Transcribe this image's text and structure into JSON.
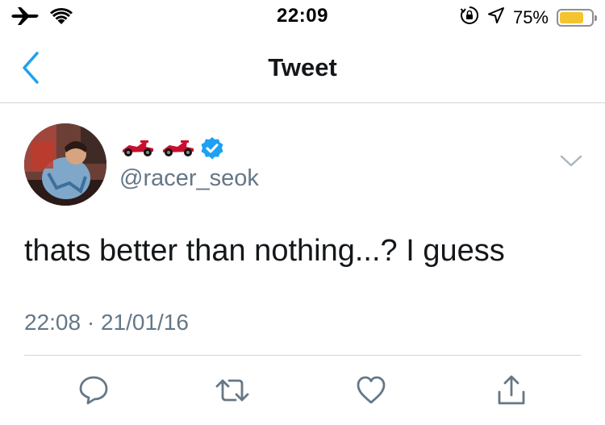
{
  "status_bar": {
    "time": "22:09",
    "battery_percent": "75%",
    "battery_level": 0.75,
    "icons": [
      "airplane-icon",
      "wifi-icon",
      "orientation-lock-icon",
      "location-icon",
      "battery-icon"
    ]
  },
  "nav": {
    "title": "Tweet",
    "back_icon": "chevron-left-icon"
  },
  "tweet": {
    "display_name_emoji": "🏎🏎",
    "verified": true,
    "handle": "@racer_seok",
    "text": "thats better than nothing...? I guess",
    "timestamp": "22:08 · 21/01/16",
    "menu_icon": "chevron-down-icon"
  },
  "actions": [
    {
      "name": "reply",
      "icon": "reply-icon"
    },
    {
      "name": "retweet",
      "icon": "retweet-icon"
    },
    {
      "name": "like",
      "icon": "heart-icon"
    },
    {
      "name": "share",
      "icon": "share-icon"
    }
  ],
  "colors": {
    "accent": "#1da1f2",
    "text_primary": "#14171a",
    "text_secondary": "#657786",
    "divider": "#cfd3d6",
    "battery": "#f4c430",
    "race_car": "#c8102e"
  }
}
